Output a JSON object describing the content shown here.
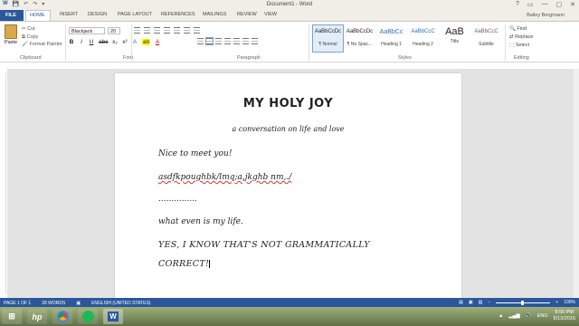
{
  "titlebar": {
    "title": "Document1 - Word",
    "qat": [
      "W",
      "💾",
      "↶",
      "↷",
      "▾"
    ],
    "controls": [
      "?",
      "▭",
      "—",
      "▢",
      "✕"
    ]
  },
  "tabs": {
    "file": "FILE",
    "items": [
      "HOME",
      "INSERT",
      "DESIGN",
      "PAGE LAYOUT",
      "REFERENCES",
      "MAILINGS",
      "REVIEW",
      "VIEW"
    ],
    "user": "Bailey Bergmann"
  },
  "ribbon": {
    "clipboard": {
      "paste": "Paste",
      "cut": "Cut",
      "copy": "Copy",
      "format_painter": "Format Painter",
      "label": "Clipboard"
    },
    "font": {
      "name": "Blackjack",
      "size": "20",
      "label": "Font",
      "buttons": [
        "B",
        "I",
        "U",
        "abc",
        "x₂",
        "x²",
        "A",
        "ab",
        "A"
      ]
    },
    "paragraph": {
      "label": "Paragraph"
    },
    "styles": {
      "label": "Styles",
      "items": [
        {
          "preview": "AaBbCcDc",
          "name": "¶ Normal"
        },
        {
          "preview": "AaBbCcDc",
          "name": "¶ No Spac..."
        },
        {
          "preview": "AaBbCc",
          "name": "Heading 1"
        },
        {
          "preview": "AaBbCcC",
          "name": "Heading 2"
        },
        {
          "preview": "AaB",
          "name": "Title"
        },
        {
          "preview": "AaBbCcC",
          "name": "Subtitle"
        }
      ]
    },
    "editing": {
      "find": "Find",
      "replace": "Replace",
      "select": "Select",
      "label": "Editing"
    }
  },
  "document": {
    "title": "MY HOLY JOY",
    "subtitle": "a conversation on life and love",
    "lines": [
      "Nice to meet you!",
      "asdfkpoughbk/lmq;a,jkghb nm,./",
      "...............",
      "what even is my life.",
      "YES, I KNOW THAT'S NOT GRAMMATICALLY",
      "CORRECT!"
    ]
  },
  "status": {
    "page": "PAGE 1 OF 1",
    "words": "28 WORDS",
    "language": "ENGLISH (UNITED STATES)",
    "zoom": "100%"
  },
  "taskbar": {
    "time": "8:50 PM",
    "date": "5/13/2015",
    "lang": "ENG"
  }
}
